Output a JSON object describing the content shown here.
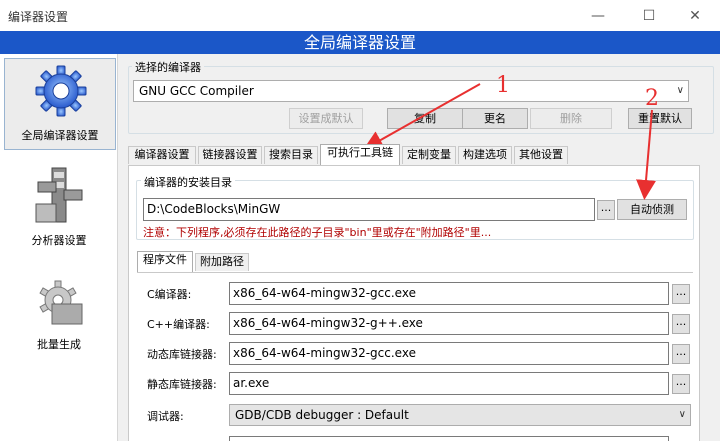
{
  "window": {
    "title": "编译器设置",
    "minimize": "—",
    "maximize": "☐",
    "close": "✕"
  },
  "banner": {
    "title": "全局编译器设置"
  },
  "nav": [
    {
      "label": "全局编译器设置",
      "icon": "gear-icon",
      "selected": true
    },
    {
      "label": "分析器设置",
      "icon": "caliper-icon",
      "selected": false
    },
    {
      "label": "批量生成",
      "icon": "batch-gear-icon",
      "selected": false
    }
  ],
  "compiler": {
    "group_label": "选择的编译器",
    "selected": "GNU GCC Compiler",
    "buttons": {
      "set_default": "设置成默认",
      "copy": "复制",
      "rename": "更名",
      "delete": "删除",
      "reset_defaults": "重置默认"
    }
  },
  "tabs": [
    "编译器设置",
    "链接器设置",
    "搜索目录",
    "可执行工具链",
    "定制变量",
    "构建选项",
    "其他设置"
  ],
  "active_tab": 3,
  "install_dir": {
    "group_label": "编译器的安装目录",
    "value": "D:\\CodeBlocks\\MinGW",
    "browse": "...",
    "auto_detect": "自动侦测",
    "note": "注意：下列程序,必须存在此路径的子目录\"bin\"里或存在\"附加路径\"里..."
  },
  "subtabs": [
    "程序文件",
    "附加路径"
  ],
  "active_subtab": 0,
  "programs": [
    {
      "label": "C编译器:",
      "value": "x86_64-w64-mingw32-gcc.exe",
      "kind": "field"
    },
    {
      "label": "C++编译器:",
      "value": "x86_64-w64-mingw32-g++.exe",
      "kind": "field"
    },
    {
      "label": "动态库链接器:",
      "value": "x86_64-w64-mingw32-gcc.exe",
      "kind": "field"
    },
    {
      "label": "静态库链接器:",
      "value": "ar.exe",
      "kind": "field"
    },
    {
      "label": "调试器:",
      "value": "GDB/CDB debugger : Default",
      "kind": "combo"
    }
  ],
  "annotations": {
    "one": "1",
    "two": "2"
  },
  "colors": {
    "banner": "#1b57c8",
    "annotation": "#e83030",
    "note": "#b00000"
  }
}
